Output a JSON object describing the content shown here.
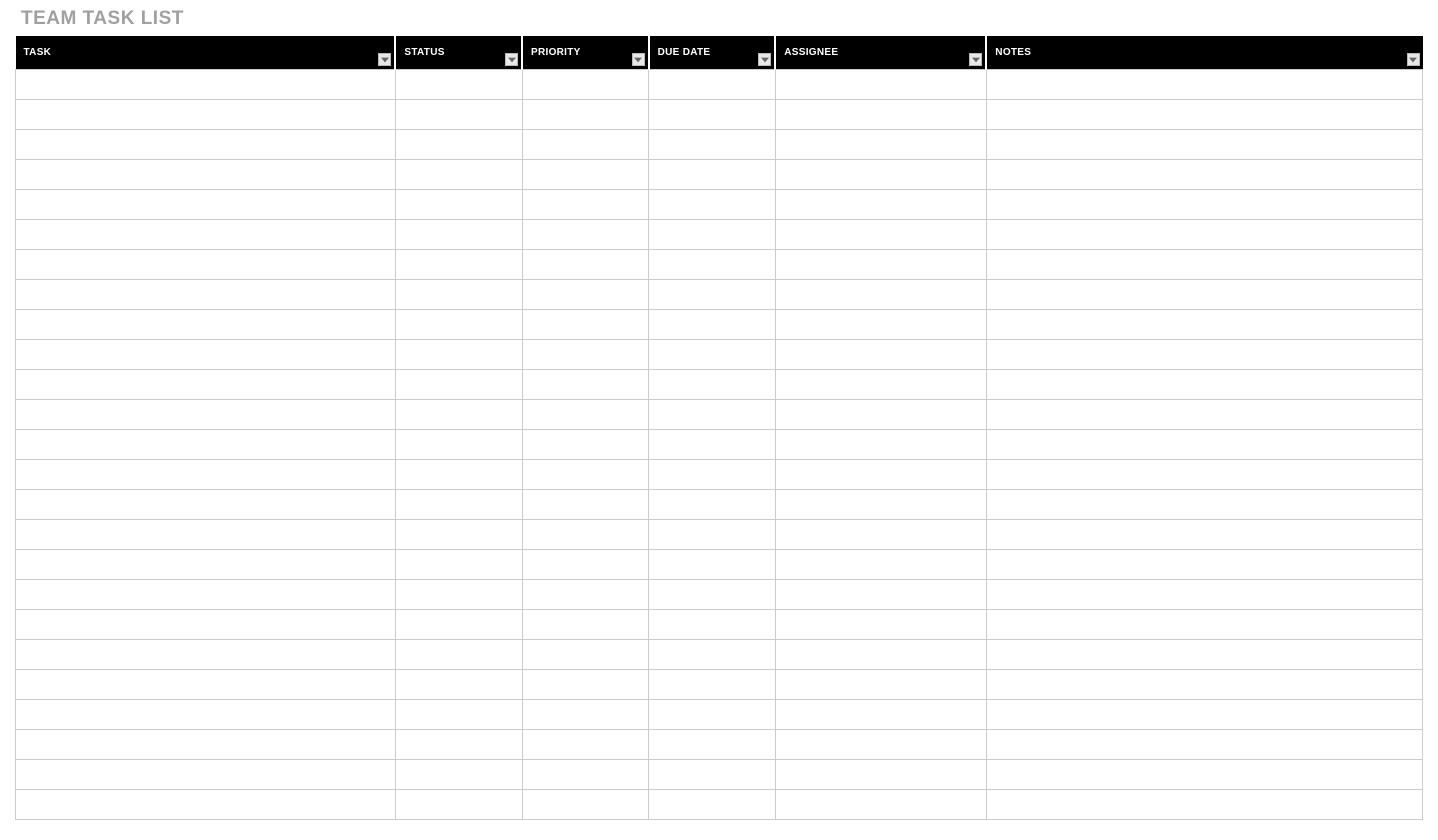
{
  "title": "TEAM TASK LIST",
  "columns": [
    {
      "label": "TASK",
      "has_filter": true
    },
    {
      "label": "STATUS",
      "has_filter": true
    },
    {
      "label": "PRIORITY",
      "has_filter": true
    },
    {
      "label": "DUE DATE",
      "has_filter": true
    },
    {
      "label": "ASSIGNEE",
      "has_filter": true
    },
    {
      "label": "NOTES",
      "has_filter": true
    }
  ],
  "rows": [
    {
      "task": "",
      "status": "",
      "priority": "",
      "due_date": "",
      "assignee": "",
      "notes": ""
    },
    {
      "task": "",
      "status": "",
      "priority": "",
      "due_date": "",
      "assignee": "",
      "notes": ""
    },
    {
      "task": "",
      "status": "",
      "priority": "",
      "due_date": "",
      "assignee": "",
      "notes": ""
    },
    {
      "task": "",
      "status": "",
      "priority": "",
      "due_date": "",
      "assignee": "",
      "notes": ""
    },
    {
      "task": "",
      "status": "",
      "priority": "",
      "due_date": "",
      "assignee": "",
      "notes": ""
    },
    {
      "task": "",
      "status": "",
      "priority": "",
      "due_date": "",
      "assignee": "",
      "notes": ""
    },
    {
      "task": "",
      "status": "",
      "priority": "",
      "due_date": "",
      "assignee": "",
      "notes": ""
    },
    {
      "task": "",
      "status": "",
      "priority": "",
      "due_date": "",
      "assignee": "",
      "notes": ""
    },
    {
      "task": "",
      "status": "",
      "priority": "",
      "due_date": "",
      "assignee": "",
      "notes": ""
    },
    {
      "task": "",
      "status": "",
      "priority": "",
      "due_date": "",
      "assignee": "",
      "notes": ""
    },
    {
      "task": "",
      "status": "",
      "priority": "",
      "due_date": "",
      "assignee": "",
      "notes": ""
    },
    {
      "task": "",
      "status": "",
      "priority": "",
      "due_date": "",
      "assignee": "",
      "notes": ""
    },
    {
      "task": "",
      "status": "",
      "priority": "",
      "due_date": "",
      "assignee": "",
      "notes": ""
    },
    {
      "task": "",
      "status": "",
      "priority": "",
      "due_date": "",
      "assignee": "",
      "notes": ""
    },
    {
      "task": "",
      "status": "",
      "priority": "",
      "due_date": "",
      "assignee": "",
      "notes": ""
    },
    {
      "task": "",
      "status": "",
      "priority": "",
      "due_date": "",
      "assignee": "",
      "notes": ""
    },
    {
      "task": "",
      "status": "",
      "priority": "",
      "due_date": "",
      "assignee": "",
      "notes": ""
    },
    {
      "task": "",
      "status": "",
      "priority": "",
      "due_date": "",
      "assignee": "",
      "notes": ""
    },
    {
      "task": "",
      "status": "",
      "priority": "",
      "due_date": "",
      "assignee": "",
      "notes": ""
    },
    {
      "task": "",
      "status": "",
      "priority": "",
      "due_date": "",
      "assignee": "",
      "notes": ""
    },
    {
      "task": "",
      "status": "",
      "priority": "",
      "due_date": "",
      "assignee": "",
      "notes": ""
    },
    {
      "task": "",
      "status": "",
      "priority": "",
      "due_date": "",
      "assignee": "",
      "notes": ""
    },
    {
      "task": "",
      "status": "",
      "priority": "",
      "due_date": "",
      "assignee": "",
      "notes": ""
    },
    {
      "task": "",
      "status": "",
      "priority": "",
      "due_date": "",
      "assignee": "",
      "notes": ""
    },
    {
      "task": "",
      "status": "",
      "priority": "",
      "due_date": "",
      "assignee": "",
      "notes": ""
    }
  ]
}
